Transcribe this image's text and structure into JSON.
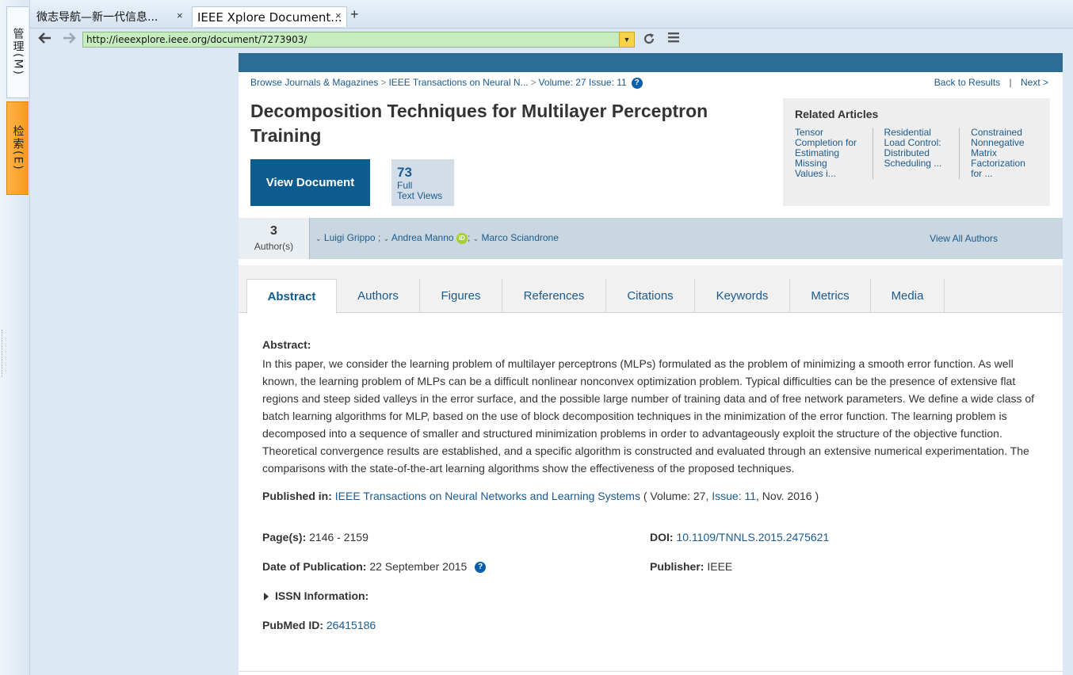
{
  "side_tabs": {
    "manage": "管理(M)",
    "search": "检索(E)"
  },
  "browser": {
    "tabs": [
      {
        "label": "微志导航—新一代信息..."
      },
      {
        "label": "IEEE Xplore Document..."
      }
    ],
    "close_glyph": "×",
    "new_tab_glyph": "+",
    "url": "http://ieeexplore.ieee.org/document/7273903/"
  },
  "icons": {
    "back": "back-arrow-icon",
    "forward": "forward-arrow-icon",
    "reload": "reload-icon",
    "menu": "hamburger-menu-icon",
    "help": "help-circle-icon",
    "orcid": "orcid-icon"
  },
  "breadcrumb": {
    "items": [
      "Browse Journals & Magazines",
      "IEEE Transactions on Neural N...",
      "Volume: 27 Issue: 11"
    ],
    "separator": ">"
  },
  "results_nav": {
    "back": "Back to Results",
    "divider": "|",
    "next": "Next >"
  },
  "article": {
    "title": "Decomposition Techniques for Multilayer Perceptron Training",
    "view_button": "View Document",
    "full_text_views_count": "73",
    "full_text_views_label1": "Full",
    "full_text_views_label2": "Text Views"
  },
  "related": {
    "heading": "Related Articles",
    "items": [
      [
        "Tensor",
        "Completion for",
        "Estimating",
        "Missing",
        "Values i..."
      ],
      [
        "Residential",
        "Load Control:",
        "Distributed",
        "Scheduling ..."
      ],
      [
        "Constrained",
        "Nonnegative",
        "Matrix",
        "Factorization",
        "for ..."
      ]
    ]
  },
  "authors": {
    "count": "3",
    "count_label": "Author(s)",
    "names": [
      "Luigi Grippo",
      "Andrea Manno",
      "Marco Sciandrone"
    ],
    "separator": ";",
    "view_all": "View All Authors"
  },
  "page_tabs": [
    "Abstract",
    "Authors",
    "Figures",
    "References",
    "Citations",
    "Keywords",
    "Metrics",
    "Media"
  ],
  "abstract": {
    "heading": "Abstract:",
    "text": "In this paper, we consider the learning problem of multilayer perceptrons (MLPs) formulated as the problem of minimizing a smooth error function. As well known, the learning problem of MLPs can be a difficult nonlinear nonconvex optimization problem. Typical difficulties can be the presence of extensive flat regions and steep sided valleys in the error surface, and the possible large number of training data and of free network parameters. We define a wide class of batch learning algorithms for MLP, based on the use of block decomposition techniques in the minimization of the error function. The learning problem is decomposed into a sequence of smaller and structured minimization problems in order to advantageously exploit the structure of the objective function. Theoretical convergence results are established, and a specific algorithm is constructed and evaluated through an extensive numerical experimentation. The comparisons with the state-of-the-art learning algorithms show the effectiveness of the proposed techniques."
  },
  "published_in": {
    "label": "Published in:",
    "journal": "IEEE Transactions on Neural Networks and Learning Systems",
    "open": "( Volume: 27,",
    "issue": "Issue: 11",
    "close": ", Nov. 2016 )"
  },
  "meta": {
    "pages_label": "Page(s):",
    "pages": "2146 - 2159",
    "doi_label": "DOI:",
    "doi": "10.1109/TNNLS.2015.2475621",
    "date_label": "Date of Publication:",
    "date": "22 September 2015",
    "publisher_label": "Publisher:",
    "publisher": "IEEE",
    "issn_label": "ISSN Information:",
    "pubmed_label": "PubMed ID:",
    "pubmed": "26415186"
  }
}
